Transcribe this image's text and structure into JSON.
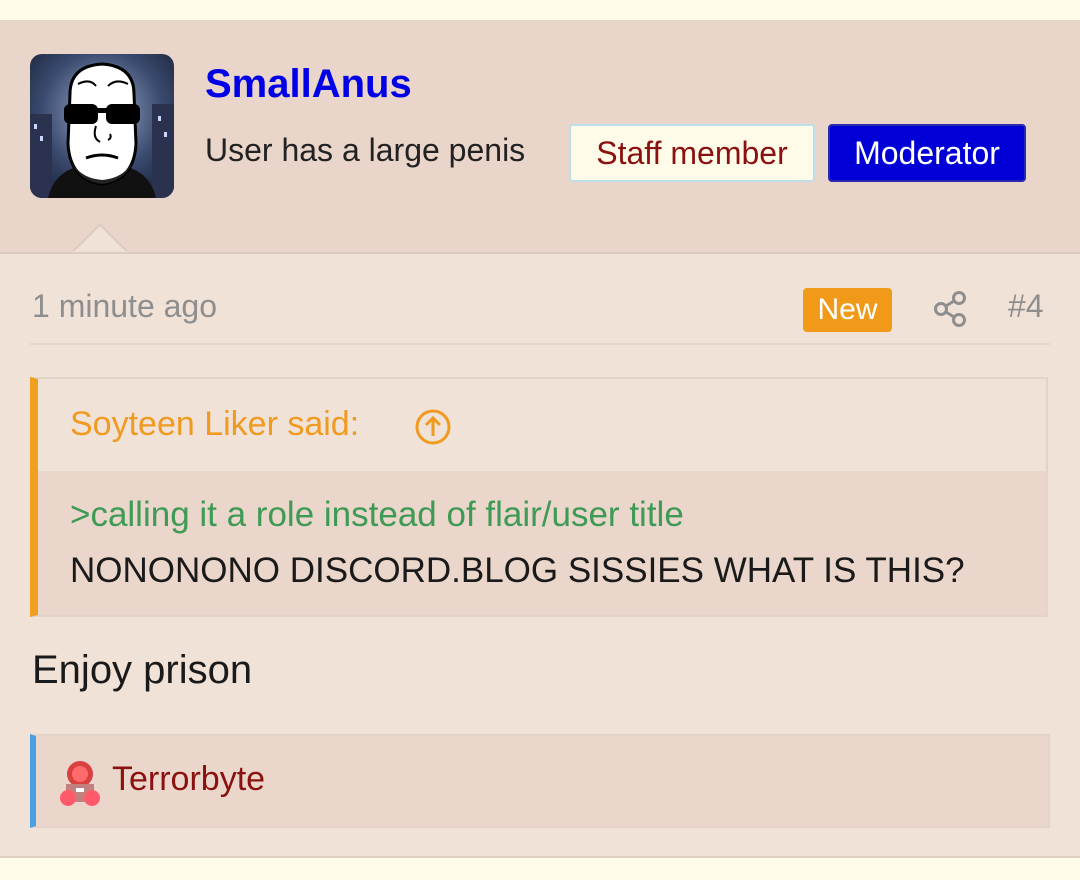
{
  "post": {
    "username": "SmallAnus",
    "user_title": "User has a large penis",
    "badges": {
      "staff": "Staff member",
      "moderator": "Moderator"
    },
    "time": "1 minute ago",
    "new_label": "New",
    "post_number": "#4",
    "message": "Enjoy prison"
  },
  "quote": {
    "author": "Soyteen Liker said:",
    "greentext": ">calling it a role instead of flair/user title",
    "body": "NONONONO DISCORD.BLOG SISSIES WHAT IS THIS?"
  },
  "reactions": {
    "user": "Terrorbyte"
  },
  "colors": {
    "username": "#0000e6",
    "moderator_badge": "#0000d6",
    "new_badge": "#f19a1a",
    "quote_accent": "#f0a020",
    "greentext": "#3e9a55",
    "reaction_accent": "#4aa0e0",
    "reaction_name": "#8b1010"
  },
  "icons": [
    "share-icon",
    "arrow-up-circle-icon"
  ]
}
